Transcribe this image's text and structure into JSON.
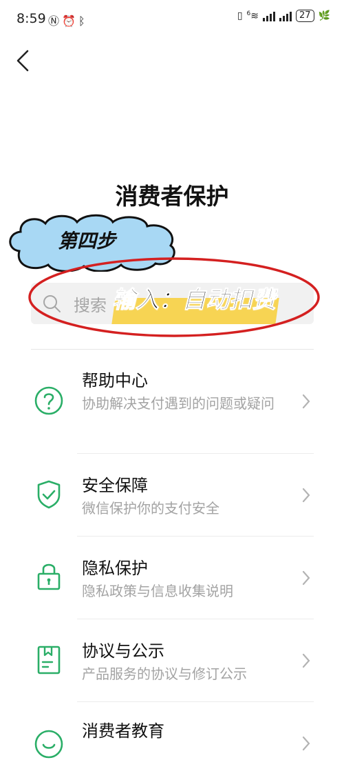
{
  "status_bar": {
    "time": "8:59",
    "left_icons": [
      "nfc-icon",
      "alarm-icon",
      "bluetooth-icon"
    ],
    "right_icons": [
      "vibrate-icon",
      "wifi-6-icon",
      "signal-icon",
      "signal-icon"
    ],
    "wifi_label": "6",
    "battery": "27"
  },
  "header": {
    "back_icon": "chevron-left-icon",
    "title": "消费者保护"
  },
  "annotation": {
    "step_label": "第四步",
    "instruction": "输入：自动扣费",
    "highlight_color": "#f7d24a",
    "ellipse_color": "#d42020",
    "cloud_color": "#a8d8f4"
  },
  "search": {
    "placeholder": "搜索"
  },
  "accent_color": "#2aae67",
  "items": [
    {
      "title": "帮助中心",
      "desc": "协助解决支付遇到的问题或疑问",
      "icon": "question-circle-icon"
    },
    {
      "title": "安全保障",
      "desc": "微信保护你的支付安全",
      "icon": "shield-check-icon"
    },
    {
      "title": "隐私保护",
      "desc": "隐私政策与信息收集说明",
      "icon": "lock-icon"
    },
    {
      "title": "协议与公示",
      "desc": "产品服务的协议与修订公示",
      "icon": "document-icon"
    },
    {
      "title": "消费者教育",
      "desc": "",
      "icon": "smile-circle-icon"
    }
  ]
}
